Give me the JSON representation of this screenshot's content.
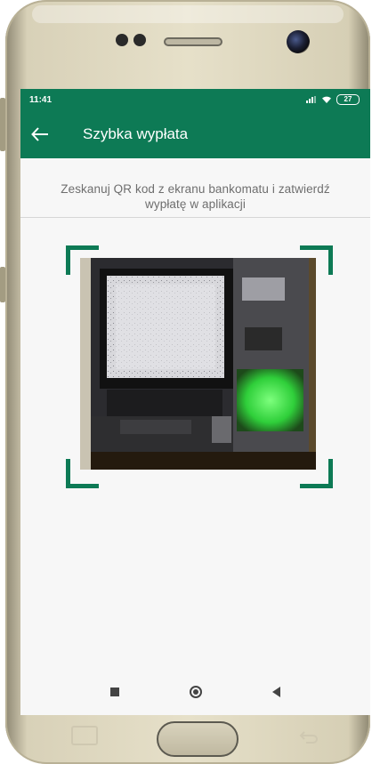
{
  "status_bar": {
    "time": "11:41",
    "battery": "27"
  },
  "app_bar": {
    "title": "Szybka wypłata"
  },
  "scanner": {
    "instruction_line1": "Zeskanuj QR kod z ekranu bankomatu i zatwierdź",
    "instruction_line2": "wypłatę w aplikacji",
    "frame_color": "#0d7a55"
  },
  "colors": {
    "primary": "#0d7a55",
    "background": "#f7f7f7",
    "text_secondary": "#6e6e6e"
  },
  "icons": {
    "back": "arrow-left-icon",
    "nav_recents": "square-icon",
    "nav_home": "circle-icon",
    "nav_back": "triangle-left-icon"
  }
}
